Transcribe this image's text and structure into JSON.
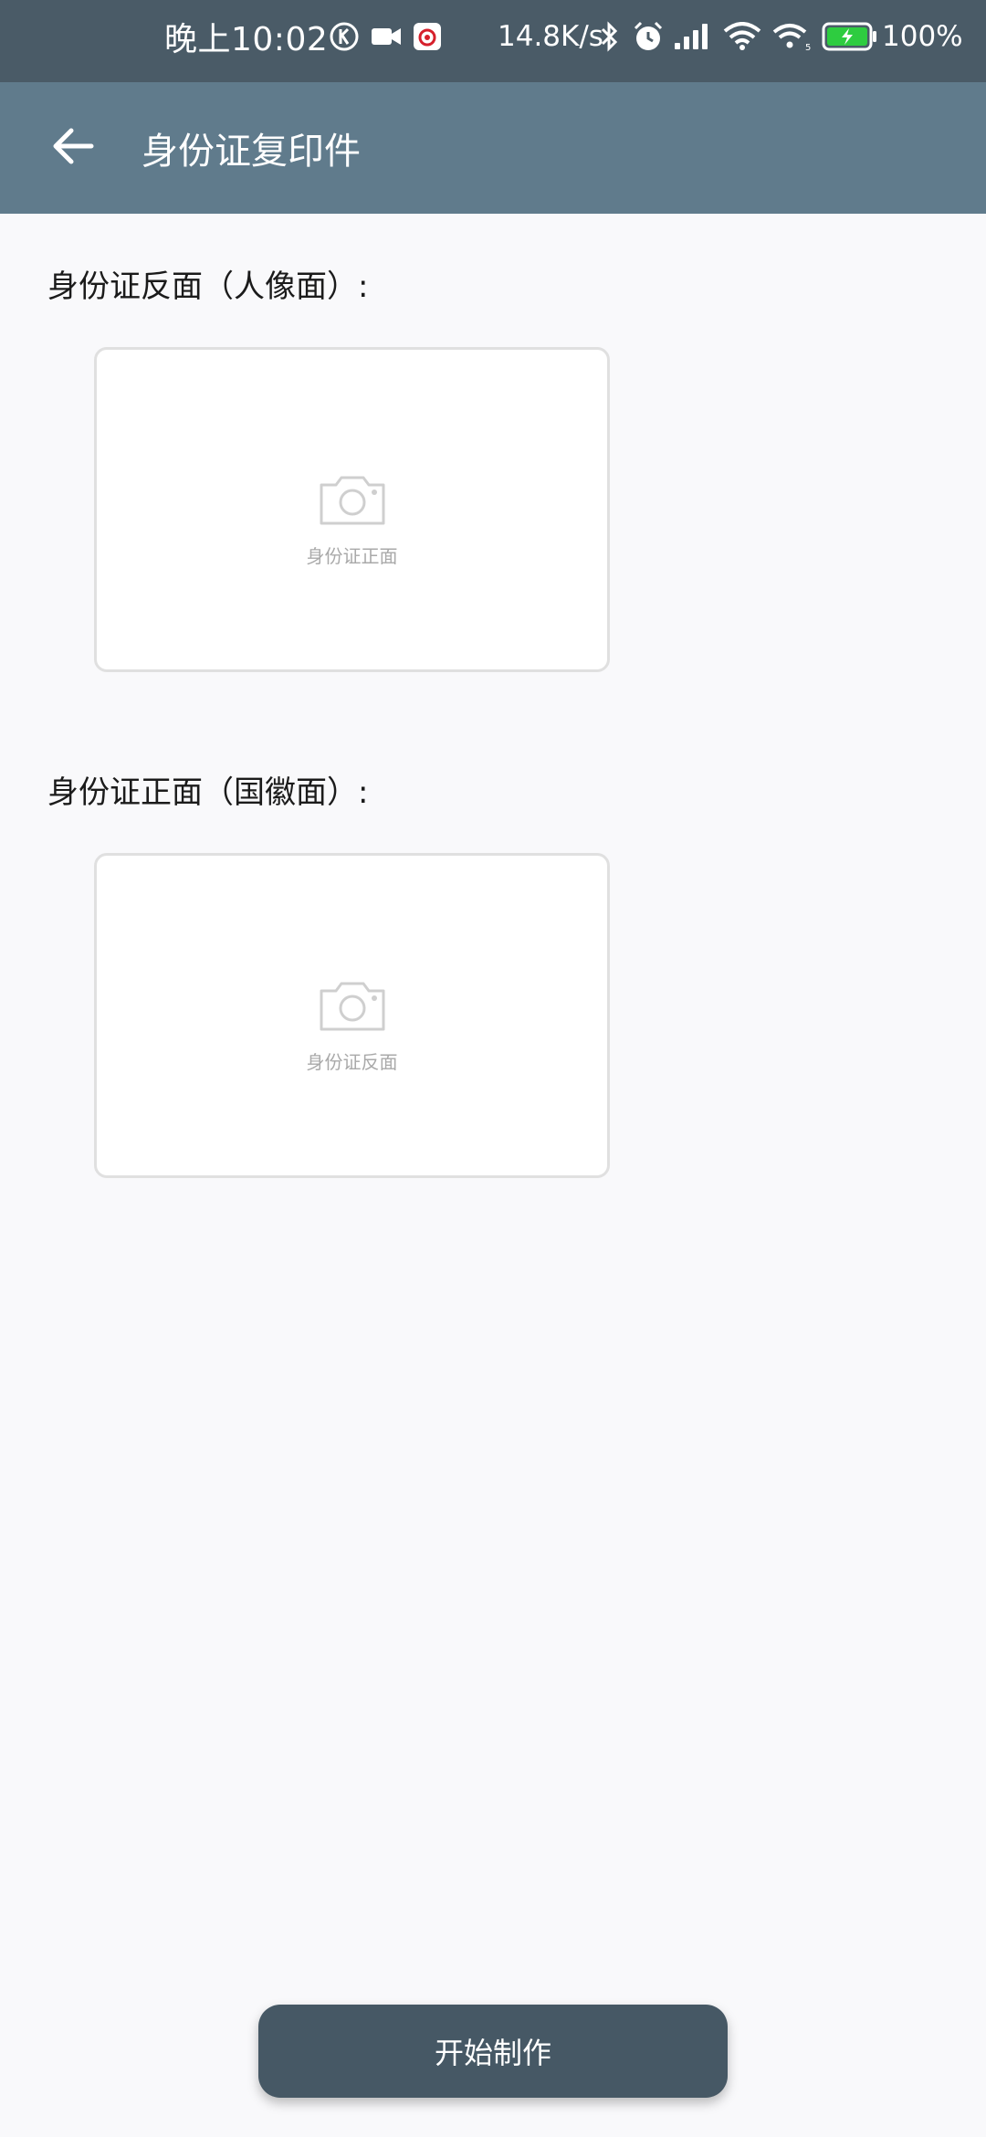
{
  "status_bar": {
    "time": "晚上10:02",
    "network_speed": "14.8K/s",
    "battery_percent": "100%",
    "icons": [
      "k-circle-icon",
      "video-camera-icon",
      "music-app-icon",
      "bluetooth-icon",
      "alarm-icon",
      "signal-bars-icon",
      "wifi-icon",
      "wifi-5g-icon",
      "battery-charging-icon"
    ],
    "battery_color": "#2ecc40"
  },
  "app_bar": {
    "title": "身份证复印件",
    "back_icon": "arrow-left-icon"
  },
  "sections": [
    {
      "label": "身份证反面（人像面）:",
      "card_caption": "身份证正面",
      "icon": "camera-icon"
    },
    {
      "label": "身份证正面（国徽面）:",
      "card_caption": "身份证反面",
      "icon": "camera-icon"
    }
  ],
  "start_button": {
    "label": "开始制作"
  },
  "colors": {
    "status_bar_bg": "#4a5b67",
    "app_bar_bg": "#607b8c",
    "page_bg": "#f9f9fb",
    "button_bg": "#465865"
  }
}
